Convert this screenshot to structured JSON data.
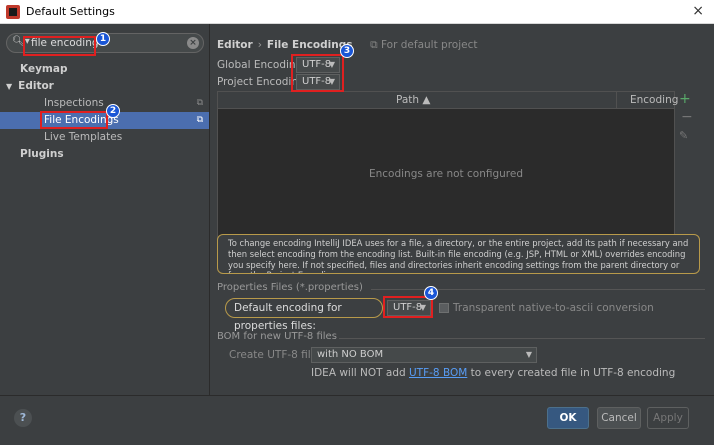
{
  "window": {
    "title": "Default Settings",
    "close_glyph": "×"
  },
  "search": {
    "value": "file encoding",
    "icon": "search-icon"
  },
  "tree": [
    {
      "label": "Keymap",
      "bold": true
    },
    {
      "label": "Editor",
      "bold": true,
      "expander": "▼"
    },
    {
      "label": "Inspections"
    },
    {
      "label": "File Encodings",
      "selected": true
    },
    {
      "label": "Live Templates"
    },
    {
      "label": "Plugins",
      "bold": true
    }
  ],
  "breadcrumb": {
    "parent": "Editor",
    "separator": "›",
    "current": "File Encodings",
    "note": "For default project"
  },
  "encoding": {
    "global_label": "Global Encoding:",
    "global_value": "UTF-8",
    "project_label": "Project Encoding:",
    "project_value": "UTF-8"
  },
  "table": {
    "col_path": "Path ▲",
    "col_encoding": "Encoding",
    "empty_text": "Encodings are not configured"
  },
  "info_text": "To change encoding IntelliJ IDEA uses for a file, a directory, or the entire project, add its path if necessary and then select encoding from the encoding list. Built-in file encoding (e.g. JSP, HTML or XML) overrides encoding you specify here. If not specified, files and directories inherit encoding settings from the parent directory or from the Project Encoding.",
  "properties": {
    "section_title": "Properties Files (*.properties)",
    "default_label": "Default encoding for properties files:",
    "default_value": "UTF-8",
    "transparent_label": "Transparent native-to-ascii conversion"
  },
  "bom": {
    "section_title": "BOM for new UTF-8 files",
    "create_label": "Create UTF-8 files:",
    "create_value": "with NO BOM",
    "note_prefix": "IDEA will NOT add",
    "note_link": "UTF-8 BOM",
    "note_suffix": "to every created file in UTF-8 encoding"
  },
  "footer": {
    "help": "?",
    "ok": "OK",
    "cancel": "Cancel",
    "apply": "Apply"
  },
  "annotations": [
    "1",
    "2",
    "3",
    "4"
  ],
  "colors": {
    "accent": "#4b6eaf",
    "annotation_red": "#e02020",
    "badge_blue": "#1a56d6",
    "link": "#589df6",
    "add_green": "#59a869"
  }
}
